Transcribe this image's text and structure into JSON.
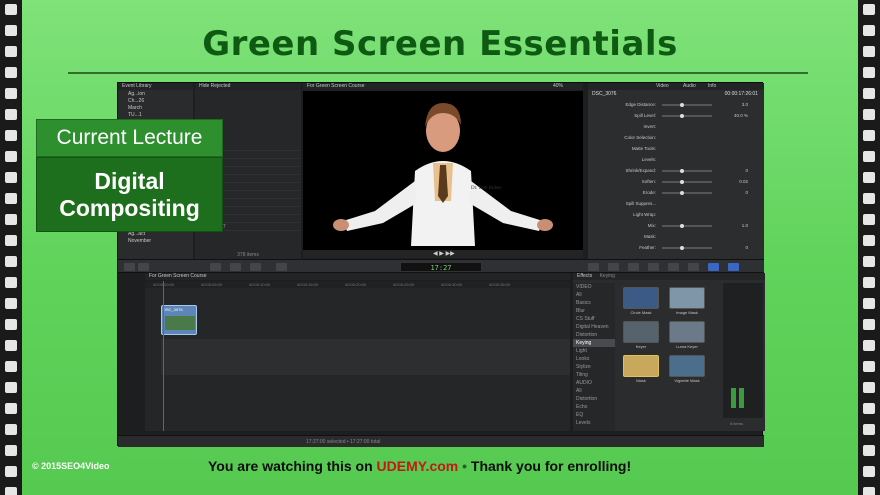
{
  "header": {
    "title": "Green Screen Essentials"
  },
  "lecture": {
    "label": "Current Lecture",
    "topic_line1": "Digital",
    "topic_line2": "Compositing"
  },
  "footer": {
    "copyright": "© 2015SEO4Video",
    "watching_prefix": "You are watching this on ",
    "udemy": "UDEMY.com",
    "separator": "•",
    "thanks": "Thank you for enrolling!"
  },
  "app": {
    "library_header": "Event Library",
    "browser_header": "Hide Rejected",
    "viewer_header": "For Green Screen Course",
    "viewer_zoom": "40%",
    "inspector_tabs": [
      "Video",
      "Audio",
      "Info"
    ],
    "inspector_clip": "DSC_3076",
    "inspector_time": "00:00:17:26:01",
    "library_items": [
      "Ag...ion",
      "Ch...26",
      "March",
      "TU...1"
    ],
    "library_items_bottom": [
      "Ag...act",
      "November"
    ],
    "clip_names": [
      "0101-020",
      "0101-021",
      "0101-022",
      "0101-023",
      "0102-000",
      "0102-001",
      "0102-002",
      "0102-003",
      "0102-005",
      "0102-006",
      "060102-007"
    ],
    "browser_count": "378 items",
    "inspector_rows": [
      {
        "label": "Edge Distance:",
        "value": "3.0"
      },
      {
        "label": "Spill Level:",
        "value": "40.0 %"
      },
      {
        "label": "Invert:",
        "value": ""
      },
      {
        "label": "Color Selection:",
        "value": ""
      },
      {
        "label": "Matte Tools:",
        "value": ""
      },
      {
        "label": "Levels:",
        "value": ""
      },
      {
        "label": "Shrink/Expand:",
        "value": "0"
      },
      {
        "label": "Soften:",
        "value": "0.02"
      },
      {
        "label": "Erode:",
        "value": "0"
      },
      {
        "label": "Spill Suppres...",
        "value": ""
      },
      {
        "label": "Light Wrap:",
        "value": ""
      },
      {
        "label": "Mix:",
        "value": "1.0"
      },
      {
        "label": "Mask:",
        "value": ""
      },
      {
        "label": "Feather:",
        "value": "0"
      }
    ],
    "timecode": "17:27",
    "timeline_header": "For Green Screen Course",
    "timeline_clip": "DSC_3076",
    "timeline_ruler": [
      "00:00:00:00",
      "00:00:05:00",
      "00:00:10:00",
      "00:00:15:00",
      "00:00:20:00",
      "00:00:25:00",
      "00:00:30:00",
      "00:00:35:00"
    ],
    "effects_header": "Effects",
    "effects_search": "Keying",
    "effects_video_label": "VIDEO",
    "effects_categories": [
      "All",
      "Basics",
      "Blur",
      "CS Stuff",
      "Digital Heaven",
      "Distortion",
      "Keying",
      "Light",
      "Looks",
      "Stylize",
      "Tiling"
    ],
    "effects_audio_label": "AUDIO",
    "effects_audio_categories": [
      "All",
      "Distortion",
      "Echo",
      "EQ",
      "Levels"
    ],
    "effects_items": [
      "Circle Mask",
      "Image Mask",
      "Keyer",
      "Luma Keyer",
      "Mask",
      "Vignette Mask"
    ],
    "effects_count": "6 items",
    "status_text": "17:27:00 selected • 17:27:00 total"
  },
  "colors": {
    "green_bg": "#5fd35a",
    "title_green": "#0e5a12",
    "lecture_green": "#1d6f1d",
    "udemy_red": "#c61616"
  }
}
